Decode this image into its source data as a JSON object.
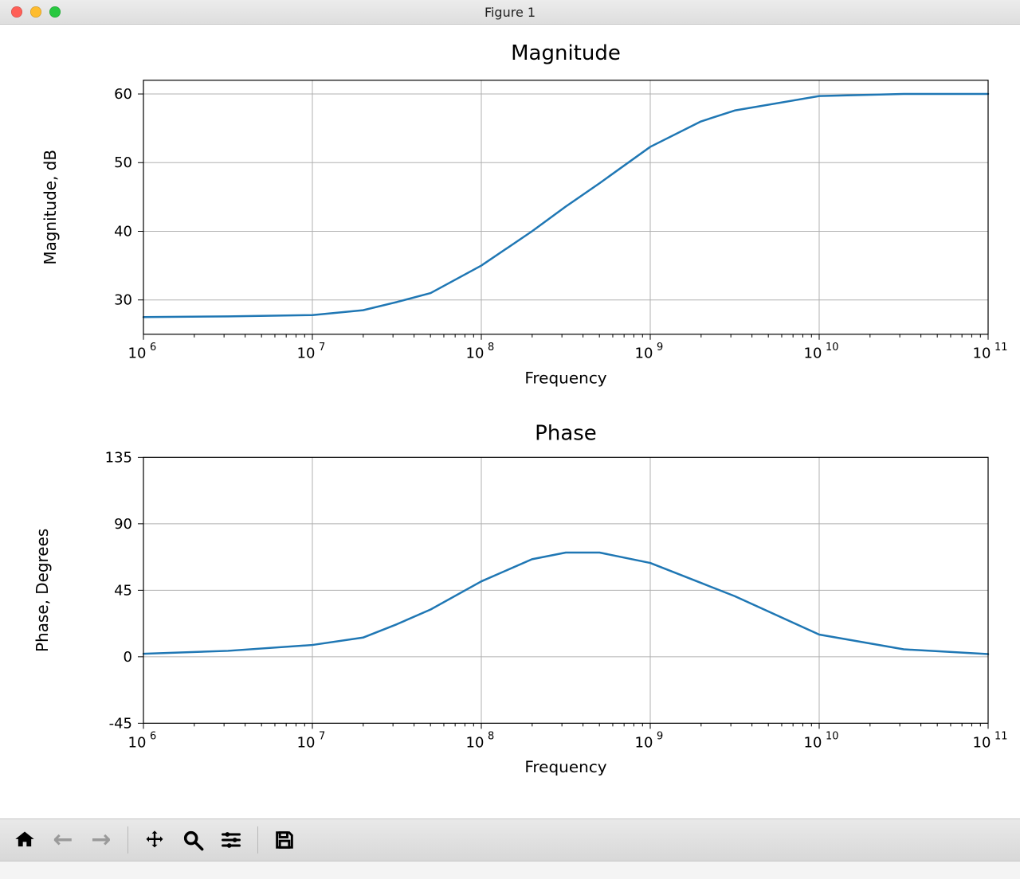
{
  "window": {
    "title": "Figure 1"
  },
  "toolbar": {
    "home_label": "Home",
    "back_label": "Back",
    "forward_label": "Forward",
    "pan_label": "Pan",
    "zoom_label": "Zoom",
    "configure_label": "Configure subplots",
    "save_label": "Save"
  },
  "plots": {
    "magnitude": {
      "title": "Magnitude",
      "xlabel": "Frequency",
      "ylabel": "Magnitude, dB",
      "xticks": [
        "10^6",
        "10^7",
        "10^8",
        "10^9",
        "10^10",
        "10^11"
      ],
      "yticks": [
        "30",
        "40",
        "50",
        "60"
      ]
    },
    "phase": {
      "title": "Phase",
      "xlabel": "Frequency",
      "ylabel": "Phase, Degrees",
      "xticks": [
        "10^6",
        "10^7",
        "10^8",
        "10^9",
        "10^10",
        "10^11"
      ],
      "yticks": [
        "-45",
        "0",
        "45",
        "90",
        "135"
      ]
    }
  },
  "chart_data": [
    {
      "type": "line",
      "title": "Magnitude",
      "xlabel": "Frequency",
      "ylabel": "Magnitude, dB",
      "xscale": "log",
      "xlim": [
        1000000.0,
        100000000000.0
      ],
      "ylim": [
        25,
        62
      ],
      "grid": true,
      "x_exp": [
        6.0,
        6.5,
        7.0,
        7.3,
        7.5,
        7.7,
        8.0,
        8.3,
        8.5,
        8.7,
        9.0,
        9.3,
        9.5,
        10.0,
        10.5,
        11.0
      ],
      "values": [
        27.5,
        27.6,
        27.8,
        28.5,
        29.7,
        31.0,
        35.0,
        40.0,
        43.6,
        47.0,
        52.3,
        56.0,
        57.6,
        59.7,
        60.0,
        60.0
      ]
    },
    {
      "type": "line",
      "title": "Phase",
      "xlabel": "Frequency",
      "ylabel": "Phase, Degrees",
      "xscale": "log",
      "xlim": [
        1000000.0,
        100000000000.0
      ],
      "ylim": [
        -45,
        135
      ],
      "grid": true,
      "x_exp": [
        6.0,
        6.5,
        7.0,
        7.3,
        7.5,
        7.7,
        8.0,
        8.3,
        8.5,
        8.7,
        9.0,
        9.3,
        9.5,
        10.0,
        10.5,
        11.0
      ],
      "values": [
        2.0,
        4.0,
        8.0,
        13.0,
        22.0,
        32.0,
        51.0,
        66.0,
        70.5,
        70.5,
        63.5,
        50.0,
        41.0,
        15.0,
        5.0,
        1.8
      ]
    }
  ]
}
